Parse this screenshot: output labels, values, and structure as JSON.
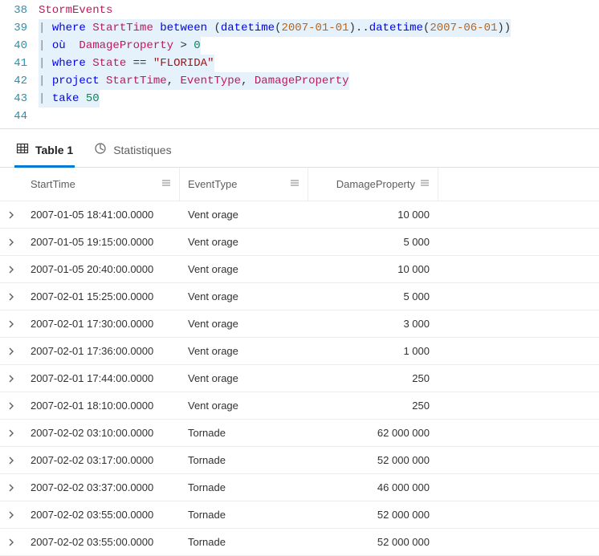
{
  "editor": {
    "lines": [
      {
        "num": 38,
        "tokens": [
          {
            "t": "StormEvents",
            "c": "tk-ident"
          }
        ],
        "hl": false
      },
      {
        "num": 39,
        "tokens": [
          {
            "t": "| ",
            "c": "tk-pipe"
          },
          {
            "t": "where ",
            "c": "tk-key"
          },
          {
            "t": "StartTime ",
            "c": "tk-col"
          },
          {
            "t": "between ",
            "c": "tk-key"
          },
          {
            "t": "(",
            "c": "tk-paren"
          },
          {
            "t": "datetime",
            "c": "tk-func"
          },
          {
            "t": "(",
            "c": "tk-paren"
          },
          {
            "t": "2007-01-01",
            "c": "tk-date"
          },
          {
            "t": ")",
            "c": "tk-paren"
          },
          {
            "t": "..",
            "c": "tk-op"
          },
          {
            "t": "datetime",
            "c": "tk-func"
          },
          {
            "t": "(",
            "c": "tk-paren"
          },
          {
            "t": "2007-06-01",
            "c": "tk-date"
          },
          {
            "t": ")",
            "c": "tk-paren"
          },
          {
            "t": ")",
            "c": "tk-paren"
          }
        ],
        "hl": true
      },
      {
        "num": 40,
        "tokens": [
          {
            "t": "| ",
            "c": "tk-pipe"
          },
          {
            "t": "où  ",
            "c": "tk-key"
          },
          {
            "t": "DamageProperty ",
            "c": "tk-col"
          },
          {
            "t": "> ",
            "c": "tk-op"
          },
          {
            "t": "0",
            "c": "tk-num"
          }
        ],
        "hl": true
      },
      {
        "num": 41,
        "tokens": [
          {
            "t": "| ",
            "c": "tk-pipe"
          },
          {
            "t": "where ",
            "c": "tk-key"
          },
          {
            "t": "State ",
            "c": "tk-col"
          },
          {
            "t": "== ",
            "c": "tk-op"
          },
          {
            "t": "\"FLORIDA\"",
            "c": "tk-str"
          }
        ],
        "hl": true
      },
      {
        "num": 42,
        "tokens": [
          {
            "t": "| ",
            "c": "tk-pipe"
          },
          {
            "t": "project ",
            "c": "tk-key"
          },
          {
            "t": "StartTime",
            "c": "tk-col"
          },
          {
            "t": ", ",
            "c": "tk-op"
          },
          {
            "t": "EventType",
            "c": "tk-col"
          },
          {
            "t": ", ",
            "c": "tk-op"
          },
          {
            "t": "DamageProperty",
            "c": "tk-col"
          }
        ],
        "hl": true
      },
      {
        "num": 43,
        "tokens": [
          {
            "t": "| ",
            "c": "tk-pipe"
          },
          {
            "t": "take ",
            "c": "tk-key"
          },
          {
            "t": "50",
            "c": "tk-num"
          }
        ],
        "hl": true
      },
      {
        "num": 44,
        "tokens": [],
        "hl": false
      }
    ]
  },
  "tabs": {
    "table_label": "Table 1",
    "stats_label": "Statistiques"
  },
  "table": {
    "columns": [
      "StartTime",
      "EventType",
      "DamageProperty"
    ],
    "rows": [
      {
        "start": "2007-01-05 18:41:00.0000",
        "event": "Vent orage",
        "damage": "10 000"
      },
      {
        "start": "2007-01-05 19:15:00.0000",
        "event": "Vent orage",
        "damage": "5 000"
      },
      {
        "start": "2007-01-05 20:40:00.0000",
        "event": "Vent orage",
        "damage": "10 000"
      },
      {
        "start": "2007-02-01 15:25:00.0000",
        "event": "Vent orage",
        "damage": "5 000"
      },
      {
        "start": "2007-02-01 17:30:00.0000",
        "event": "Vent orage",
        "damage": "3 000"
      },
      {
        "start": "2007-02-01 17:36:00.0000",
        "event": "Vent orage",
        "damage": "1 000"
      },
      {
        "start": "2007-02-01 17:44:00.0000",
        "event": "Vent orage",
        "damage": "250"
      },
      {
        "start": "2007-02-01 18:10:00.0000",
        "event": "Vent orage",
        "damage": "250"
      },
      {
        "start": "2007-02-02 03:10:00.0000",
        "event": "Tornade",
        "damage": "62 000 000"
      },
      {
        "start": "2007-02-02 03:17:00.0000",
        "event": "Tornade",
        "damage": "52 000 000"
      },
      {
        "start": "2007-02-02 03:37:00.0000",
        "event": "Tornade",
        "damage": "46 000 000"
      },
      {
        "start": "2007-02-02 03:55:00.0000",
        "event": "Tornade",
        "damage": "52 000 000"
      },
      {
        "start": "2007-02-02 03:55:00.0000",
        "event": "Tornade",
        "damage": "52 000 000"
      }
    ]
  }
}
